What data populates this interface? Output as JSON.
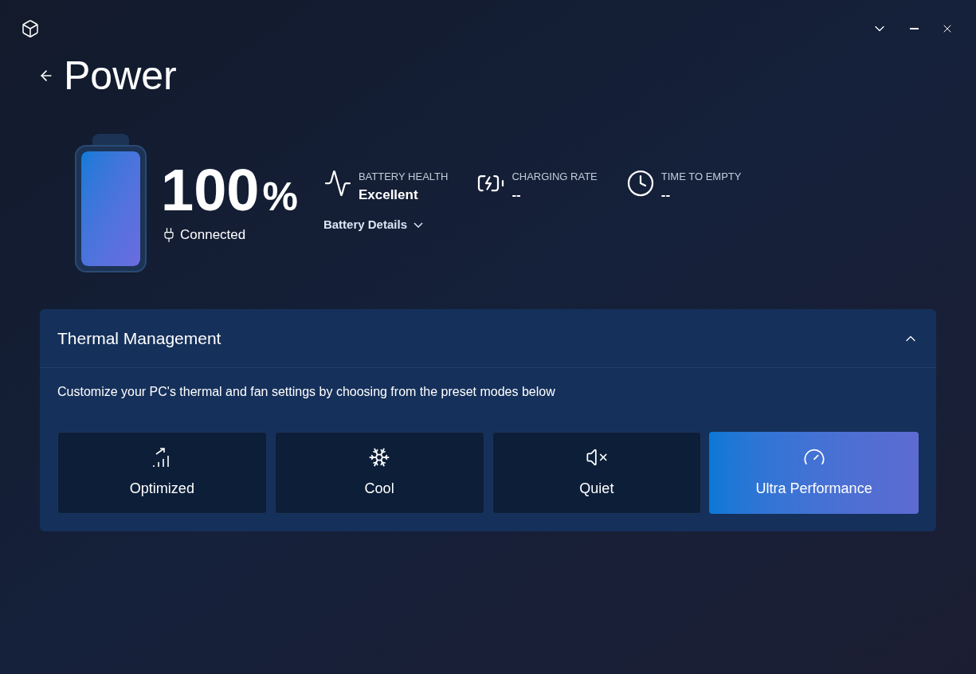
{
  "page": {
    "title": "Power"
  },
  "battery": {
    "level": 1,
    "percent": "100",
    "unit": "%",
    "status": "Connected",
    "stats": [
      {
        "kind": "health",
        "label": "BATTERY HEALTH",
        "value": "Excellent"
      },
      {
        "kind": "charging",
        "label": "CHARGING RATE",
        "value": "--"
      },
      {
        "kind": "time",
        "label": "TIME TO EMPTY",
        "value": "--"
      }
    ],
    "details_link": "Battery Details"
  },
  "thermal": {
    "title": "Thermal Management",
    "expanded": true,
    "description": "Customize your PC's thermal and fan settings by choosing from the preset modes below",
    "modes": [
      {
        "kind": "optimized",
        "label": "Optimized",
        "selected": false
      },
      {
        "kind": "cool",
        "label": "Cool",
        "selected": false
      },
      {
        "kind": "quiet",
        "label": "Quiet",
        "selected": false
      },
      {
        "kind": "ultra",
        "label": "Ultra Performance",
        "selected": true
      }
    ]
  }
}
